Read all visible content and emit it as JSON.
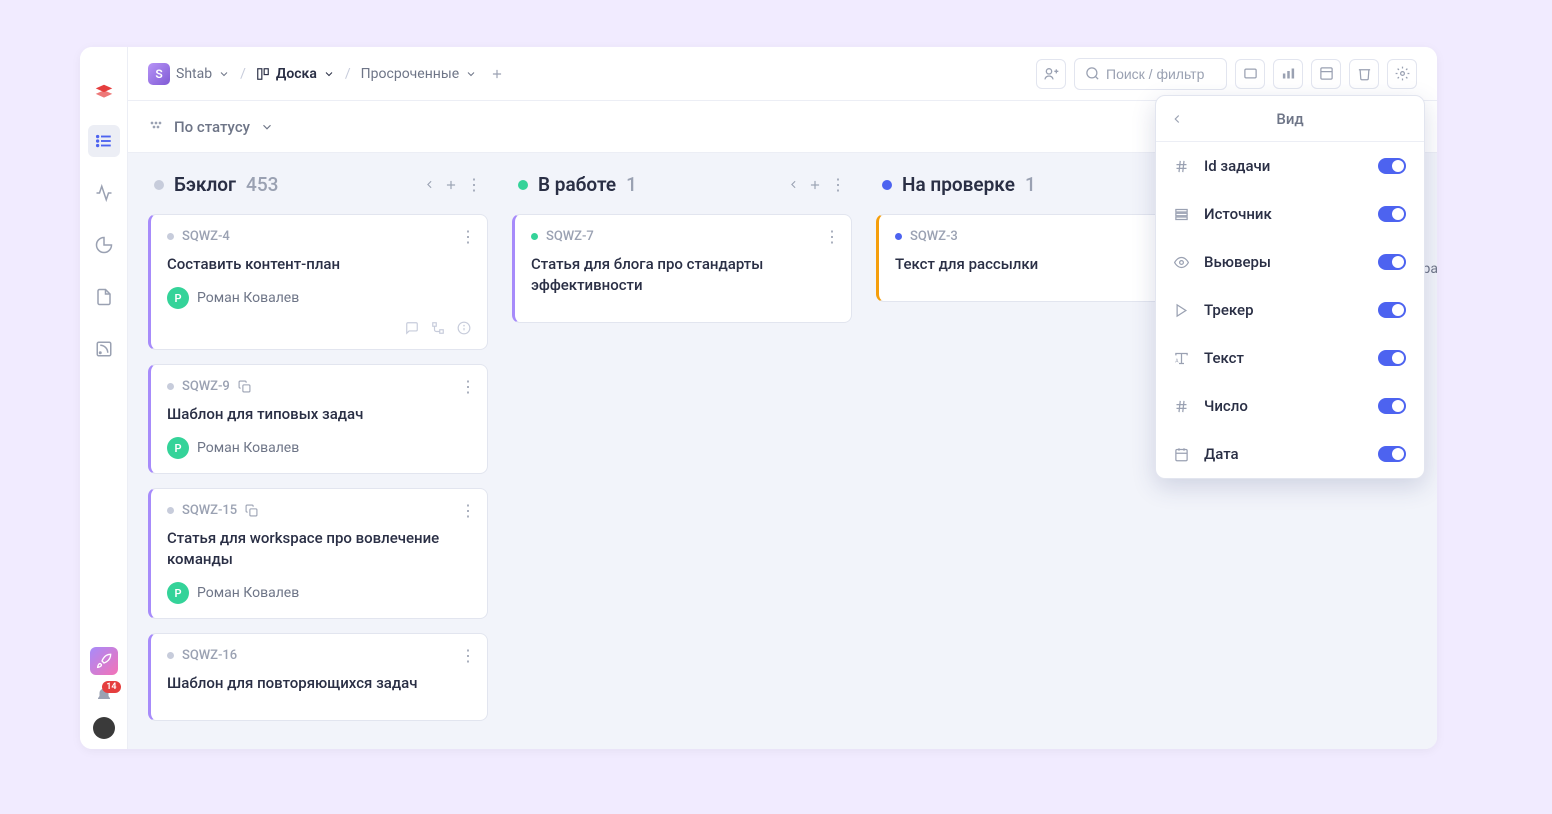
{
  "breadcrumb": {
    "workspace": "Shtab",
    "board_label": "Доска",
    "filter_label": "Просроченные"
  },
  "search": {
    "placeholder": "Поиск / фильтр"
  },
  "grouping": {
    "label": "По статусу"
  },
  "columns": [
    {
      "dot_color": "#c7ccdb",
      "border_color": "#a78bfa",
      "title": "Бэклог",
      "count": "453",
      "cards": [
        {
          "id": "SQWZ-4",
          "dot": "#c7ccdb",
          "title": "Составить контент-план",
          "assignee_initial": "Р",
          "assignee": "Роман Ковалев",
          "footer_icons": true
        },
        {
          "id": "SQWZ-9",
          "dot": "#c7ccdb",
          "title": "Шаблон для типовых задач",
          "assignee_initial": "Р",
          "assignee": "Роман Ковалев",
          "copy": true
        },
        {
          "id": "SQWZ-15",
          "dot": "#c7ccdb",
          "title": "Статья для workspace про вовлечение команды",
          "assignee_initial": "Р",
          "assignee": "Роман Ковалев",
          "copy": true
        },
        {
          "id": "SQWZ-16",
          "dot": "#c7ccdb",
          "title": "Шаблон для повторяющихся задач"
        }
      ]
    },
    {
      "dot_color": "#34d399",
      "border_color": "#a78bfa",
      "title": "В работе",
      "count": "1",
      "cards": [
        {
          "id": "SQWZ-7",
          "dot": "#34d399",
          "title": "Статья для блога про стандарты эффективности"
        }
      ]
    },
    {
      "dot_color": "#4d63f0",
      "border_color": "#f59e0b",
      "title": "На проверке",
      "count": "1",
      "cards": [
        {
          "id": "SQWZ-3",
          "dot": "#4d63f0",
          "title": "Текст для рассылки"
        }
      ]
    }
  ],
  "popup": {
    "title": "Вид",
    "rows": [
      {
        "icon": "#",
        "label": "Id задачи"
      },
      {
        "icon": "source",
        "label": "Источник"
      },
      {
        "icon": "eye",
        "label": "Вьюверы"
      },
      {
        "icon": "play",
        "label": "Трекер"
      },
      {
        "icon": "text",
        "label": "Текст"
      },
      {
        "icon": "#",
        "label": "Число"
      },
      {
        "icon": "calendar",
        "label": "Дата"
      }
    ]
  },
  "notifications": {
    "count": "14"
  },
  "clipped_text": "кера"
}
